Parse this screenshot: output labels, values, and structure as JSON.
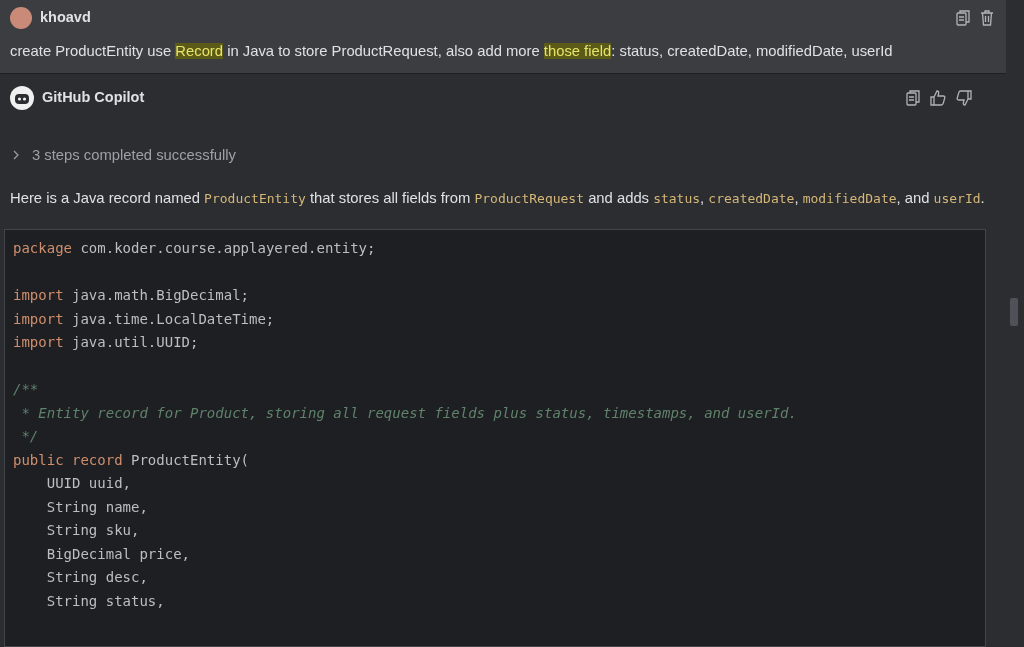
{
  "user_message": {
    "author": "khoavd",
    "segments": [
      {
        "text": "create ProductEntity use ",
        "highlighted": false
      },
      {
        "text": "Record",
        "highlighted": true
      },
      {
        "text": " in Java to store ProductRequest, also add more ",
        "highlighted": false
      },
      {
        "text": "those field",
        "highlighted": true
      },
      {
        "text": ": status, createdDate, modifiedDate, userId",
        "highlighted": false
      }
    ]
  },
  "assistant": {
    "name": "GitHub Copilot",
    "steps": {
      "label": "3 steps completed successfully",
      "expanded": false
    },
    "intro": [
      {
        "kind": "text",
        "text": "Here is a Java record named "
      },
      {
        "kind": "code",
        "text": "ProductEntity"
      },
      {
        "kind": "text",
        "text": " that stores all fields from "
      },
      {
        "kind": "code",
        "text": "ProductRequest"
      },
      {
        "kind": "text",
        "text": " and adds "
      },
      {
        "kind": "code",
        "text": "status"
      },
      {
        "kind": "text",
        "text": ", "
      },
      {
        "kind": "code",
        "text": "createdDate"
      },
      {
        "kind": "text",
        "text": ", "
      },
      {
        "kind": "code",
        "text": "modifiedDate"
      },
      {
        "kind": "text",
        "text": ", and "
      },
      {
        "kind": "code",
        "text": "userId"
      },
      {
        "kind": "text",
        "text": "."
      }
    ],
    "code_blocks": [
      [
        [
          {
            "kind": "keyword",
            "text": "package"
          },
          {
            "kind": "plain",
            "text": " com.koder.course.applayered.entity;"
          }
        ]
      ],
      [
        [
          {
            "kind": "keyword",
            "text": "import"
          },
          {
            "kind": "plain",
            "text": " java.math.BigDecimal;"
          }
        ],
        [
          {
            "kind": "keyword",
            "text": "import"
          },
          {
            "kind": "plain",
            "text": " java.time.LocalDateTime;"
          }
        ],
        [
          {
            "kind": "keyword",
            "text": "import"
          },
          {
            "kind": "plain",
            "text": " java.util.UUID;"
          }
        ]
      ],
      [
        [
          {
            "kind": "comment",
            "text": "/**"
          }
        ],
        [
          {
            "kind": "comment",
            "text": " * Entity record for Product, storing all request fields plus status, timestamps, and userId."
          }
        ],
        [
          {
            "kind": "comment",
            "text": " */"
          }
        ],
        [
          {
            "kind": "keyword",
            "text": "public record"
          },
          {
            "kind": "plain",
            "text": " ProductEntity("
          }
        ],
        [
          {
            "kind": "plain",
            "text": "    UUID uuid,"
          }
        ],
        [
          {
            "kind": "plain",
            "text": "    String name,"
          }
        ],
        [
          {
            "kind": "plain",
            "text": "    String sku,"
          }
        ],
        [
          {
            "kind": "plain",
            "text": "    BigDecimal price,"
          }
        ],
        [
          {
            "kind": "plain",
            "text": "    String desc,"
          }
        ],
        [
          {
            "kind": "plain",
            "text": "    String status,"
          }
        ]
      ]
    ]
  }
}
